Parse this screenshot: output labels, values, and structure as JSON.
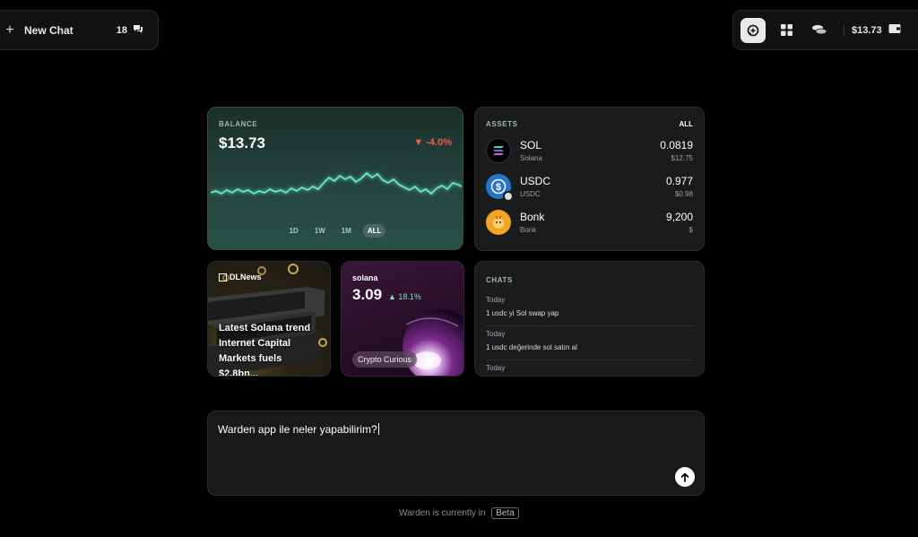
{
  "topbar_left": {
    "new_chat_label": "New Chat",
    "chat_count": "18"
  },
  "topbar_right": {
    "balance": "$13.73",
    "icons": [
      "chat-plus-icon",
      "grid-icon",
      "coins-icon",
      "wallet-icon"
    ]
  },
  "balance_card": {
    "label": "BALANCE",
    "amount": "$13.73",
    "change": "▼ -4.0%",
    "ranges": [
      "1D",
      "1W",
      "1M",
      "ALL"
    ],
    "selected_range": "ALL",
    "accent": "#5ee8c4",
    "negative_color": "#f05a4a"
  },
  "assets_card": {
    "label": "ASSETS",
    "all_label": "ALL",
    "items": [
      {
        "symbol": "SOL",
        "name": "Solana",
        "amount": "0.0819",
        "usd": "$12.75"
      },
      {
        "symbol": "USDC",
        "name": "USDC",
        "amount": "0.977",
        "usd": "$0.98"
      },
      {
        "symbol": "Bonk",
        "name": "Bonk",
        "amount": "9,200",
        "usd": "$"
      }
    ]
  },
  "news_card": {
    "source": "DLNews",
    "headline": "Latest Solana trend Internet Capital Markets fuels $2.8bn..."
  },
  "token_card": {
    "name": "solana",
    "price": "3.09",
    "change": "▲ 18.1%",
    "tag": "Crypto Curious"
  },
  "chats_card": {
    "label": "CHATS",
    "items": [
      {
        "date": "Today",
        "text": "1 usdc yi Sol swap yap"
      },
      {
        "date": "Today",
        "text": "1 usdc değerinde sol satın al"
      },
      {
        "date": "Today",
        "text": ""
      }
    ]
  },
  "composer": {
    "value": "Warden app ile neler yapabilirim?"
  },
  "footer": {
    "text": "Warden is currently in",
    "badge": "Beta"
  }
}
